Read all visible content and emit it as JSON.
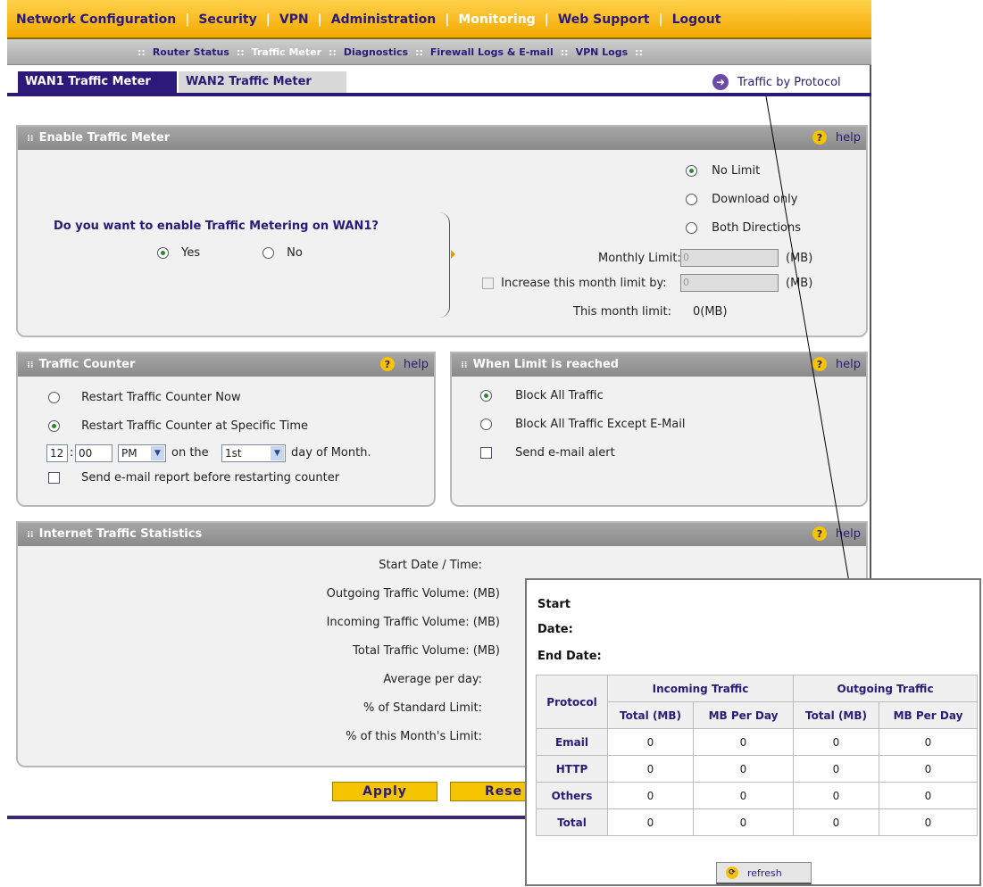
{
  "topnav": {
    "items": [
      {
        "label": "Network Configuration",
        "active": false
      },
      {
        "label": "Security",
        "active": false
      },
      {
        "label": "VPN",
        "active": false
      },
      {
        "label": "Administration",
        "active": false
      },
      {
        "label": "Monitoring",
        "active": true
      },
      {
        "label": "Web Support",
        "active": false
      },
      {
        "label": "Logout",
        "active": false
      }
    ],
    "separator": "|"
  },
  "subnav": {
    "items": [
      {
        "label": "Router Status",
        "active": false
      },
      {
        "label": "Traffic Meter",
        "active": true
      },
      {
        "label": "Diagnostics",
        "active": false
      },
      {
        "label": "Firewall Logs & E-mail",
        "active": false
      },
      {
        "label": "VPN Logs",
        "active": false
      }
    ],
    "separator": "::"
  },
  "tabs": {
    "wan1": "WAN1 Traffic Meter",
    "wan2": "WAN2 Traffic Meter"
  },
  "traffic_by_protocol": "Traffic by Protocol",
  "help_label": "help",
  "enable": {
    "title": "Enable Traffic Meter",
    "question": "Do you want to enable Traffic Metering on WAN1?",
    "yes": "Yes",
    "no": "No",
    "selected": "Yes",
    "limit_options": [
      "No Limit",
      "Download only",
      "Both Directions"
    ],
    "limit_selected": "No Limit",
    "monthly_limit_label": "Monthly Limit:",
    "monthly_limit_value": "0",
    "increase_label": "Increase this month limit by:",
    "increase_value": "0",
    "unit": "(MB)",
    "this_month_label": "This month limit:",
    "this_month_value": "0(MB)"
  },
  "counter": {
    "title": "Traffic Counter",
    "restart_now": "Restart Traffic Counter Now",
    "restart_specific": "Restart Traffic Counter at Specific Time",
    "hour": "12",
    "colon": ":",
    "minute": "00",
    "ampm": "PM",
    "on_the": "on the",
    "day": "1st",
    "day_of_month": "day of Month.",
    "send_report": "Send e-mail report before restarting counter"
  },
  "limit_reached": {
    "title": "When Limit is reached",
    "block_all": "Block All Traffic",
    "block_except": "Block All Traffic Except E-Mail",
    "send_alert": "Send e-mail alert"
  },
  "stats": {
    "title": "Internet Traffic Statistics",
    "rows": [
      "Start Date / Time:",
      "Outgoing Traffic Volume: (MB)",
      "Incoming Traffic Volume: (MB)",
      "Total Traffic Volume: (MB)",
      "Average per day:",
      "% of Standard Limit:",
      "% of this Month's Limit:"
    ]
  },
  "buttons": {
    "apply": "Apply",
    "reset": "Rese"
  },
  "popup": {
    "start": "Start",
    "date": "Date:",
    "end_date": "End Date:",
    "protocol": "Protocol",
    "incoming": "Incoming Traffic",
    "outgoing": "Outgoing Traffic",
    "total_mb": "Total (MB)",
    "mb_per_day": "MB Per Day",
    "rows": [
      {
        "name": "Email",
        "v": [
          "0",
          "0",
          "0",
          "0"
        ]
      },
      {
        "name": "HTTP",
        "v": [
          "0",
          "0",
          "0",
          "0"
        ]
      },
      {
        "name": "Others",
        "v": [
          "0",
          "0",
          "0",
          "0"
        ]
      },
      {
        "name": "Total",
        "v": [
          "0",
          "0",
          "0",
          "0"
        ]
      }
    ],
    "refresh": "refresh"
  }
}
